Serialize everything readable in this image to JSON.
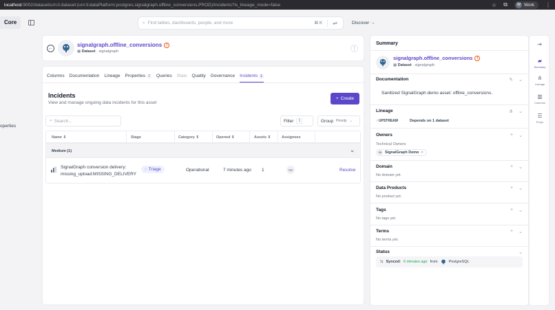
{
  "browser": {
    "url_host": "localhost",
    "url_rest": ":9002/dataset/urn:li:dataset:(urn:li:dataPlatform:postgres,signalgraph.offline_conversions,PROD)/Incidents?is_lineage_mode=false",
    "profile_initial": "W",
    "profile_label": "Work"
  },
  "app": {
    "brand": "Core",
    "search_placeholder": "Find tables, dashboards, people, and more",
    "search_shortcut": "⌘ K",
    "discover_label": "Discover →",
    "left_partial_label": "operties"
  },
  "entity": {
    "name": "signalgraph.offline_conversions",
    "type": "Dataset",
    "platform_path": "signalgraph"
  },
  "tabs": [
    {
      "label": "Columns"
    },
    {
      "label": "Documentation"
    },
    {
      "label": "Lineage"
    },
    {
      "label": "Properties",
      "badge": "7"
    },
    {
      "label": "Queries"
    },
    {
      "label": "Stats"
    },
    {
      "label": "Quality"
    },
    {
      "label": "Governance"
    },
    {
      "label": "Incidents",
      "badge": "1"
    }
  ],
  "incidents": {
    "title": "Incidents",
    "subtitle": "View and manage ongoing data incidents for this asset",
    "create_label": "Create",
    "search_placeholder": "Search...",
    "filter_label": "Filter",
    "filter_count": "1",
    "group_label": "Group",
    "group_value": "Priority",
    "columns": [
      "Name",
      "Stage",
      "Category",
      "Opened",
      "Assets",
      "Assignees"
    ],
    "group_row_label": "Medium (1)",
    "rows": [
      {
        "name": "SignalGraph conversion delivery: missing_upload:MISSING_DELIVERY",
        "stage": "Triage",
        "category": "Operational",
        "opened": "7 minutes ago",
        "assets": "1",
        "assignee_initials": "SD",
        "action": "Resolve"
      }
    ]
  },
  "summary": {
    "title": "Summary",
    "documentation_title": "Documentation",
    "documentation_text": "Sanitized SignalGraph demo asset: offline_conversions.",
    "lineage_title": "Lineage",
    "lineage_upstream": "UPSTREAM",
    "lineage_depends": "Depends on 1 dataset",
    "owners_title": "Owners",
    "owners_subtitle": "Technical Owners",
    "owner_name": "SignalGraph Demo",
    "owner_initials": "SD",
    "domain_title": "Domain",
    "domain_empty": "No domain yet.",
    "data_products_title": "Data Products",
    "data_products_empty": "No product yet.",
    "tags_title": "Tags",
    "tags_empty": "No tags yet.",
    "terms_title": "Terms",
    "terms_empty": "No terms yet.",
    "status_title": "Status",
    "status_synced": "Synced:",
    "status_time": "6 minutes ago",
    "status_from": "from",
    "status_source": "PostgreSQL"
  },
  "rail": {
    "summary": "Summary",
    "lineage": "Lineage",
    "columns": "Columns",
    "props": "Props"
  },
  "colors": {
    "accent": "#5b47c9",
    "warning": "#ea580c",
    "synced": "#16a34a"
  }
}
